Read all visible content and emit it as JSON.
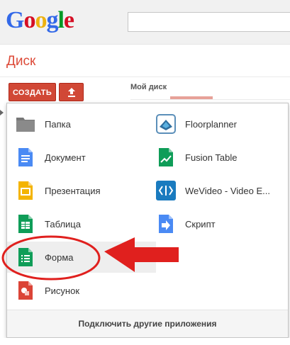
{
  "header": {
    "logo": [
      "G",
      "o",
      "o",
      "g",
      "l",
      "e"
    ]
  },
  "drive": {
    "title": "Диск",
    "create_label": "СОЗДАТЬ",
    "section_label": "Мой диск"
  },
  "menu": {
    "left": [
      {
        "label": "Папка",
        "icon": "folder-icon"
      },
      {
        "label": "Документ",
        "icon": "document-icon"
      },
      {
        "label": "Презентация",
        "icon": "presentation-icon"
      },
      {
        "label": "Таблица",
        "icon": "spreadsheet-icon"
      },
      {
        "label": "Форма",
        "icon": "form-icon"
      },
      {
        "label": "Рисунок",
        "icon": "drawing-icon"
      }
    ],
    "right": [
      {
        "label": "Floorplanner",
        "icon": "floorplanner-icon"
      },
      {
        "label": "Fusion Table",
        "icon": "fusion-table-icon"
      },
      {
        "label": "WeVideo - Video E...",
        "icon": "wevideo-icon"
      },
      {
        "label": "Скрипт",
        "icon": "script-icon"
      }
    ],
    "footer": "Подключить другие приложения"
  },
  "colors": {
    "accent": "#d14836",
    "annotation": "#e0201e"
  }
}
